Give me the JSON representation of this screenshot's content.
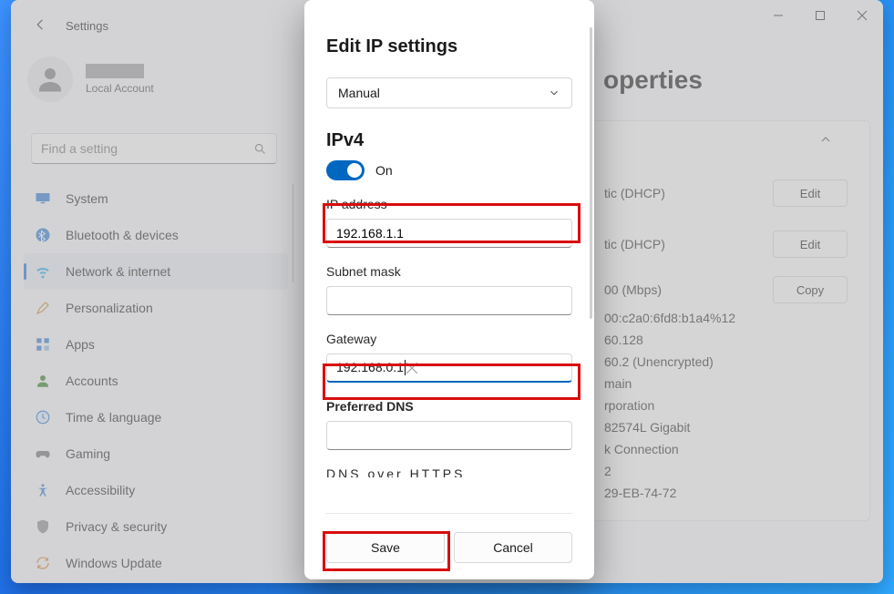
{
  "app": {
    "title": "Settings"
  },
  "profile": {
    "account_type": "Local Account"
  },
  "search": {
    "placeholder": "Find a setting"
  },
  "nav": [
    {
      "id": "system",
      "label": "System"
    },
    {
      "id": "bluetooth",
      "label": "Bluetooth & devices"
    },
    {
      "id": "network",
      "label": "Network & internet"
    },
    {
      "id": "personalization",
      "label": "Personalization"
    },
    {
      "id": "apps",
      "label": "Apps"
    },
    {
      "id": "accounts",
      "label": "Accounts"
    },
    {
      "id": "time",
      "label": "Time & language"
    },
    {
      "id": "gaming",
      "label": "Gaming"
    },
    {
      "id": "accessibility",
      "label": "Accessibility"
    },
    {
      "id": "privacy",
      "label": "Privacy & security"
    },
    {
      "id": "update",
      "label": "Windows Update"
    }
  ],
  "main": {
    "title_suffix": "operties",
    "rows": [
      {
        "value": "tic (DHCP)",
        "button": "Edit"
      },
      {
        "value": "tic (DHCP)",
        "button": "Edit"
      },
      {
        "value": "00 (Mbps)",
        "button": "Copy"
      },
      {
        "value": "00:c2a0:6fd8:b1a4%12"
      },
      {
        "value": "60.128"
      },
      {
        "value": "60.2 (Unencrypted)"
      },
      {
        "value": "main"
      },
      {
        "value": "rporation"
      },
      {
        "value": "82574L Gigabit"
      },
      {
        "value": "k Connection"
      },
      {
        "value": "2"
      },
      {
        "value": "29-EB-74-72"
      }
    ]
  },
  "dialog": {
    "title": "Edit IP settings",
    "mode": "Manual",
    "section": "IPv4",
    "toggle_label": "On",
    "fields": {
      "ip_label": "IP address",
      "ip_value": "192.168.1.1",
      "subnet_label": "Subnet mask",
      "subnet_value": "",
      "gateway_label": "Gateway",
      "gateway_value": "192.168.0.1",
      "dns_label": "Preferred DNS",
      "dns_value": "",
      "clipped_label": "DNS over HTTPS"
    },
    "buttons": {
      "save": "Save",
      "cancel": "Cancel"
    }
  }
}
